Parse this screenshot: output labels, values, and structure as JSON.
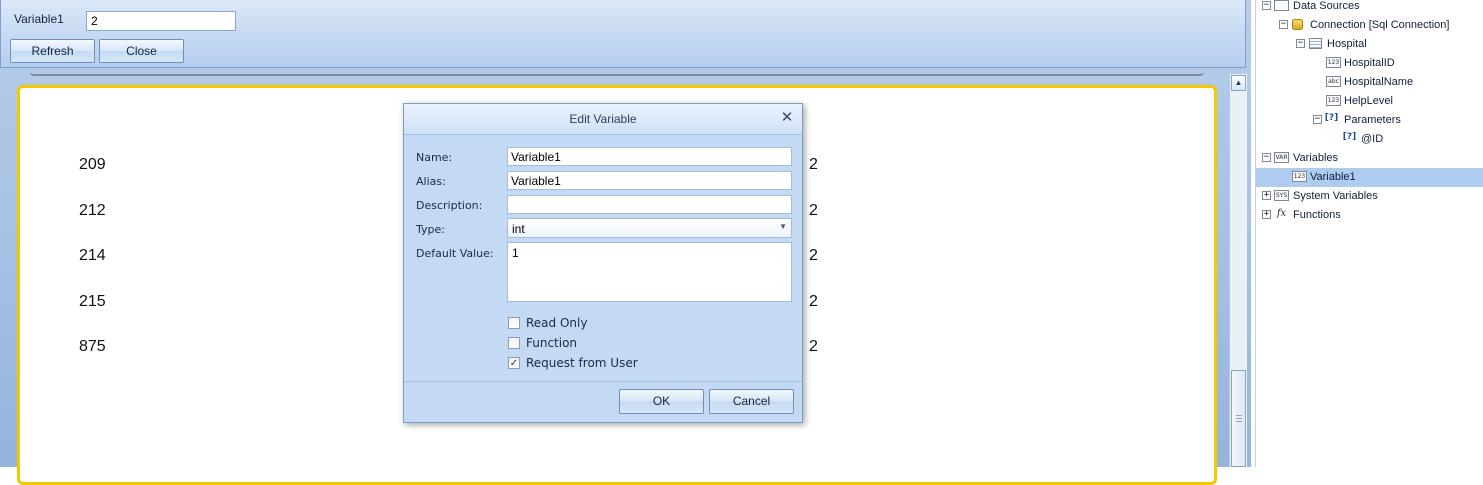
{
  "parameters_panel": {
    "variable_label": "Variable1",
    "variable_value": "2",
    "refresh_label": "Refresh",
    "close_label": "Close"
  },
  "report": {
    "left_column": [
      "209",
      "212",
      "214",
      "215",
      "875"
    ],
    "right_column": [
      "2",
      "2",
      "2",
      "2",
      "2"
    ]
  },
  "dialog": {
    "title": "Edit Variable",
    "name_label": "Name:",
    "name_value": "Variable1",
    "alias_label": "Alias:",
    "alias_value": "Variable1",
    "description_label": "Description:",
    "description_value": "",
    "type_label": "Type:",
    "type_value": "int",
    "default_value_label": "Default Value:",
    "default_value": "1",
    "read_only_label": "Read Only",
    "read_only_checked": false,
    "function_label": "Function",
    "function_checked": false,
    "request_from_user_label": "Request from User",
    "request_from_user_checked": true,
    "ok_label": "OK",
    "cancel_label": "Cancel"
  },
  "tree": {
    "data_sources": "Data Sources",
    "connection": "Connection [Sql Connection]",
    "hospital": "Hospital",
    "columns": [
      "HospitalID",
      "HospitalName",
      "HelpLevel"
    ],
    "column_icons": [
      "123",
      "abc",
      "123"
    ],
    "parameters": "Parameters",
    "param_id": "@ID",
    "variables": "Variables",
    "variable1": "Variable1",
    "system_variables": "System Variables",
    "functions": "Functions",
    "selected_item": "Variable1"
  },
  "colors": {
    "page_border": "#f2c900",
    "selection": "#aecbf0",
    "panel": "#c9dcf3"
  }
}
